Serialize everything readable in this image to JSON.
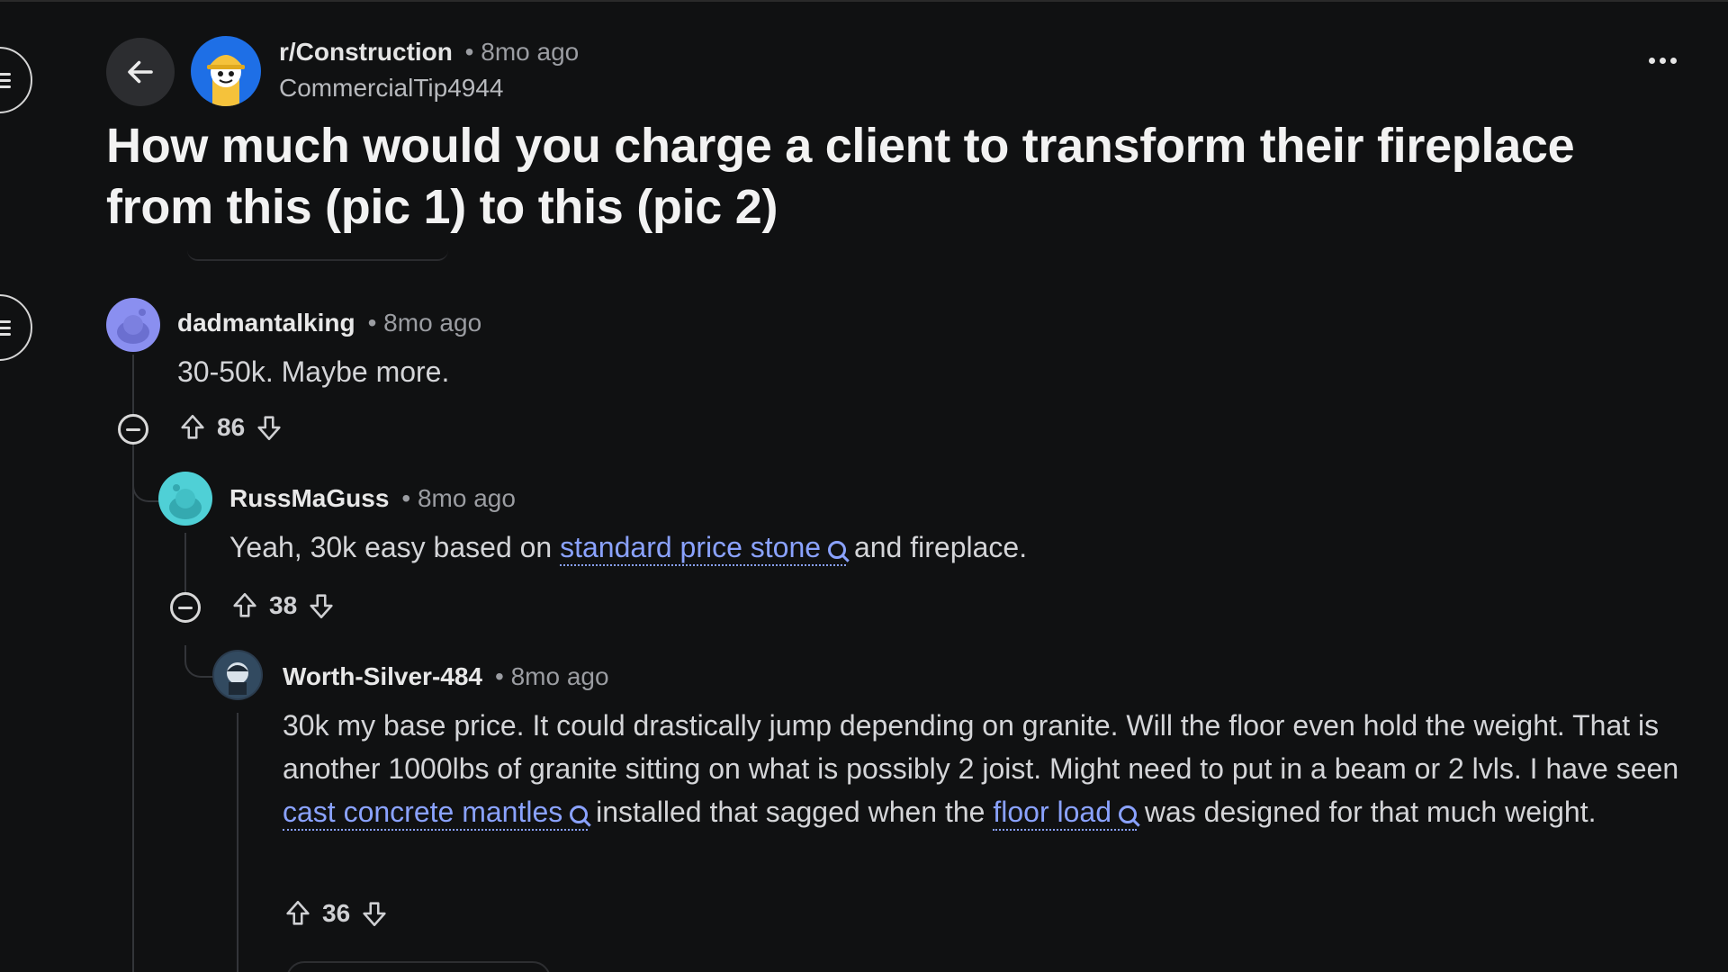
{
  "header": {
    "subreddit": "r/Construction",
    "subreddit_time": "• 8mo ago",
    "author": "CommercialTip4944",
    "title": "How much would you charge a client to transform their fireplace from this (pic 1) to this (pic 2)"
  },
  "comments": [
    {
      "username": "dadmantalking",
      "time": "• 8mo ago",
      "text": "30-50k. Maybe more.",
      "votes": "86",
      "avatar_color": "#8a8ff0"
    },
    {
      "username": "RussMaGuss",
      "time": "• 8mo ago",
      "text_before": "Yeah, 30k easy based on",
      "link": "standard price stone",
      "text_after": "and fireplace.",
      "votes": "38",
      "avatar_color": "#4fd0d6"
    },
    {
      "username": "Worth-Silver-484",
      "time": "• 8mo ago",
      "text_part1": "30k my base price. It could drastically jump depending on granite. Will the floor even hold the weight. That is another 1000lbs of granite sitting on what is possibly 2 joist. Might need to put in a beam or 2 lvls. I have seen",
      "link1": "cast concrete mantles",
      "text_part2": "installed that sagged when the",
      "link2": "floor load",
      "text_part3": "was designed for that much weight.",
      "votes": "36"
    }
  ],
  "colors": {
    "background": "#101112",
    "link": "#8aa2ff",
    "subreddit_avatar": "#1e6fe6"
  },
  "icons": [
    "menu-icon",
    "back-arrow-icon",
    "more-options-icon",
    "upvote-icon",
    "downvote-icon",
    "collapse-icon",
    "search-icon"
  ]
}
